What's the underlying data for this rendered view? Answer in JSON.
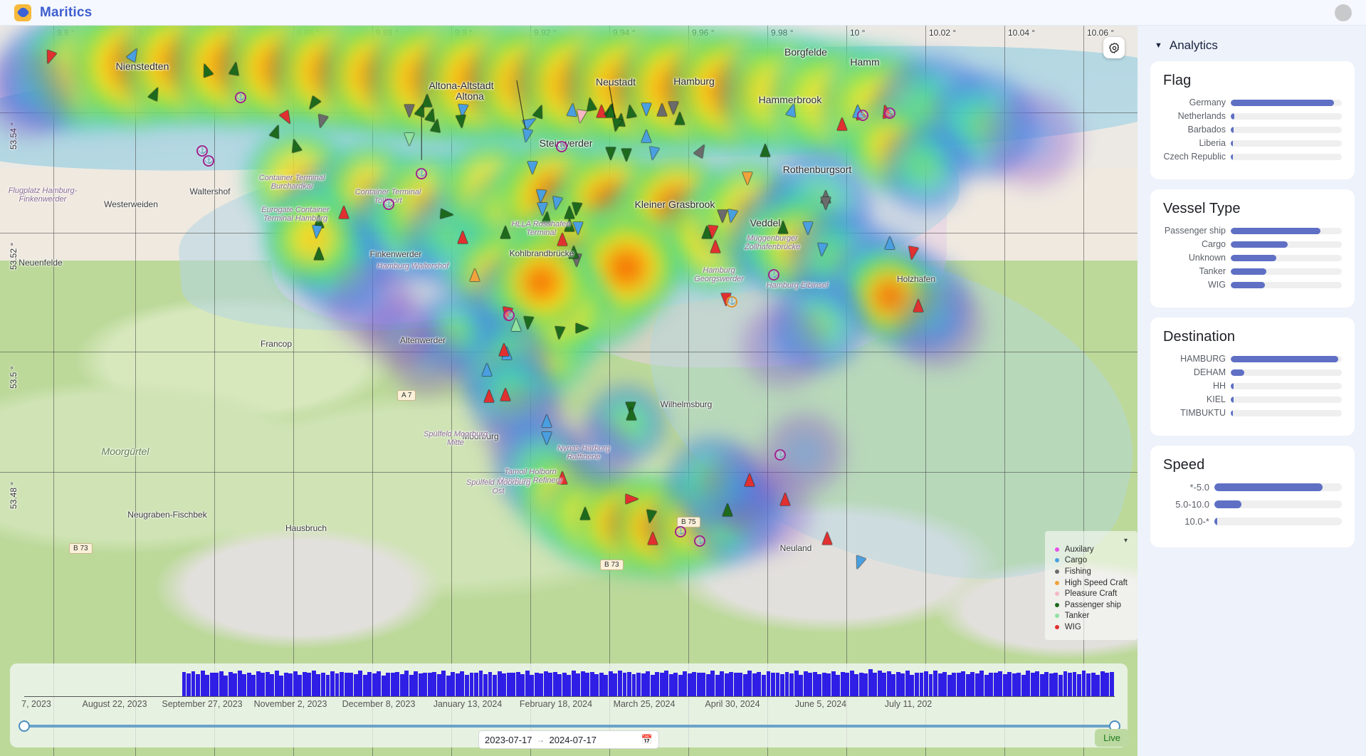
{
  "app": {
    "brand": "Maritics",
    "logo_icon": "compass-rose-icon",
    "avatar_icon": "user-avatar"
  },
  "map": {
    "gear_icon": "gear-icon",
    "longitude_labels": [
      "9.8 °",
      "9.82 °",
      "9.84 °",
      "9.86 °",
      "9.88 °",
      "9.9 °",
      "9.92 °",
      "9.94 °",
      "9.96 °",
      "9.98 °",
      "10 °",
      "10.02 °",
      "10.04 °",
      "10.06 °"
    ],
    "latitude_labels": [
      "53.54 °",
      "53.52 °",
      "53.5 °",
      "53.48 °"
    ],
    "place_labels": [
      "Nienstedten",
      "Altona-Altstadt",
      "Altona",
      "Neustadt",
      "Hamburg",
      "Hammerbrook",
      "Borgfelde",
      "Hamm",
      "Rothenburgsort",
      "Veddel",
      "Kleiner Grasbrook",
      "Steinwerder",
      "Finkenwerder",
      "Waltershof",
      "Neuenfelde",
      "Francop",
      "Altenwerder",
      "Moorburg",
      "Wilhelmsburg",
      "Hausbruch",
      "Neugraben-Fischbek",
      "Neuland",
      "Moorgürtel",
      "Kohlbrandbrücke",
      "Westerweiden",
      "Holzhafen"
    ],
    "port_labels": [
      "Container Terminal Burchardkai",
      "Eurogate Container Terminal Hamburg",
      "Container Terminal Tollerort",
      "HLLA Rosshafen Terminal",
      "Hamburg Waltershof",
      "Hamburg Georgswerder",
      "Hamburg Eibinsel",
      "Tamoil Holborn Hamburg Refinery",
      "Nynas Harburg Raffinerie",
      "Spülfeld Moorburg Mitte",
      "Spülfeld Moorburg Ost",
      "Flugplatz Hamburg-Finkenwerder",
      "Müggenburger Zollhafenbrücke"
    ],
    "road_shields": [
      "A 7",
      "B 73",
      "B 75",
      "B 73"
    ],
    "legend": {
      "title_icon": "chevron-down-icon",
      "items": [
        {
          "label": "Auxilary",
          "color": "#e84fe8"
        },
        {
          "label": "Cargo",
          "color": "#4a9fe0"
        },
        {
          "label": "Fishing",
          "color": "#6b6b6b"
        },
        {
          "label": "High Speed Craft",
          "color": "#f0a33c"
        },
        {
          "label": "Pleasure Craft",
          "color": "#f4b8c4"
        },
        {
          "label": "Passenger ship",
          "color": "#1d6a1d"
        },
        {
          "label": "Tanker",
          "color": "#90e0a0"
        },
        {
          "label": "WIG",
          "color": "#e03030"
        }
      ]
    }
  },
  "timeline": {
    "tick_labels": [
      "7, 2023",
      "August 22, 2023",
      "September 27, 2023",
      "November 2, 2023",
      "December 8, 2023",
      "January 13, 2024",
      "February 18, 2024",
      "March 25, 2024",
      "April 30, 2024",
      "June 5, 2024",
      "July 11, 202"
    ],
    "bar_color": "#2f1ee6",
    "date_from": "2023-07-17",
    "date_to": "2024-07-17",
    "range_arrow": "→",
    "calendar_icon": "calendar-icon",
    "live_label": "Live",
    "slider_left_pct": 0,
    "slider_right_pct": 100,
    "histogram_values": [
      0,
      0,
      0,
      0,
      0,
      0,
      0,
      0,
      0,
      0,
      0,
      0,
      0,
      0,
      0,
      0,
      0,
      0,
      0,
      0,
      0,
      0,
      0,
      0,
      0,
      0,
      0,
      0,
      0,
      0,
      0,
      0,
      0,
      0,
      88,
      82,
      90,
      80,
      92,
      78,
      86,
      84,
      90,
      76,
      88,
      82,
      94,
      80,
      86,
      78,
      90,
      84,
      88,
      80,
      92,
      76,
      86,
      82,
      90,
      78,
      88,
      84,
      92,
      80,
      86,
      78,
      90,
      82,
      88,
      84,
      86,
      80,
      92,
      78,
      88,
      82,
      90,
      76,
      86,
      84,
      88,
      80,
      92,
      78,
      90,
      82,
      86,
      84,
      88,
      80,
      92,
      76,
      88,
      82,
      90,
      78,
      86,
      84,
      92,
      80,
      88,
      78,
      90,
      82,
      86,
      84,
      88,
      80,
      92,
      78,
      86,
      82,
      90,
      84,
      88,
      80,
      86,
      78,
      92,
      82,
      90,
      84,
      88,
      80,
      86,
      78,
      90,
      82,
      92,
      84,
      88,
      80,
      86,
      82,
      90,
      78,
      88,
      84,
      92,
      80,
      86,
      78,
      90,
      82,
      88,
      84,
      86,
      80,
      92,
      78,
      90,
      82,
      88,
      84,
      86,
      80,
      92,
      82,
      88,
      78,
      90,
      84,
      86,
      80,
      88,
      82,
      92,
      78,
      90,
      84,
      88,
      80,
      86,
      82,
      90,
      78,
      88,
      84,
      92,
      80,
      86,
      82,
      98,
      86,
      92,
      84,
      90,
      80,
      88,
      82,
      94,
      78,
      86,
      84,
      90,
      80,
      92,
      82,
      88,
      78,
      86,
      84,
      90,
      80,
      88,
      82,
      92,
      78,
      86,
      84,
      90,
      80,
      88,
      82,
      86,
      78,
      92,
      84,
      90,
      80,
      88,
      82,
      86,
      78,
      90,
      84,
      88,
      80,
      92,
      82,
      86,
      78,
      90,
      84,
      88
    ]
  },
  "sidebar": {
    "header": "Analytics",
    "header_caret": "caret-down-icon",
    "accent": "#5e6fc4",
    "track": "#efefef",
    "cards": [
      {
        "title": "Flag",
        "rows": [
          {
            "label": "Germany",
            "pct": 93
          },
          {
            "label": "Netherlands",
            "pct": 3
          },
          {
            "label": "Barbados",
            "pct": 2.4
          },
          {
            "label": "Liberia",
            "pct": 1.2
          },
          {
            "label": "Czech Republic",
            "pct": 1.2
          }
        ]
      },
      {
        "title": "Vessel Type",
        "rows": [
          {
            "label": "Passenger ship",
            "pct": 81
          },
          {
            "label": "Cargo",
            "pct": 51
          },
          {
            "label": "Unknown",
            "pct": 41
          },
          {
            "label": "Tanker",
            "pct": 32
          },
          {
            "label": "WIG",
            "pct": 31
          }
        ]
      },
      {
        "title": "Destination",
        "rows": [
          {
            "label": "HAMBURG",
            "pct": 97
          },
          {
            "label": "DEHAM",
            "pct": 12
          },
          {
            "label": "HH",
            "pct": 2.4
          },
          {
            "label": "KIEL",
            "pct": 2.4
          },
          {
            "label": "TIMBUKTU",
            "pct": 1.6
          }
        ]
      },
      {
        "title": "Speed",
        "speed": true,
        "rows": [
          {
            "label": "*-5.0",
            "pct": 85
          },
          {
            "label": "5.0-10.0",
            "pct": 21
          },
          {
            "label": "10.0-*",
            "pct": 2
          }
        ]
      }
    ]
  }
}
